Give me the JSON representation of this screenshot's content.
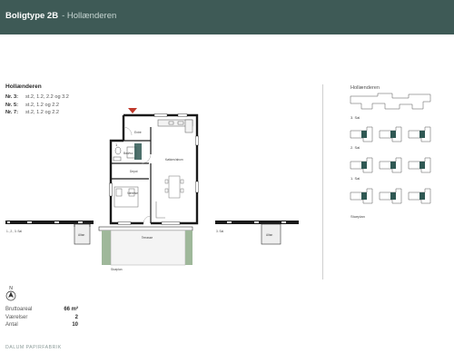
{
  "header": {
    "title": "Boligtype 2B",
    "subtitle": "- Hollænderen"
  },
  "project_label": "Hollænderen",
  "units": [
    {
      "nr": "Nr. 3:",
      "floors": "st.2, 1.2, 2.2 og 3.2"
    },
    {
      "nr": "Nr. 5:",
      "floors": "st.2, 1.2 og 2.2"
    },
    {
      "nr": "Nr. 7:",
      "floors": "st.2, 1.2 og 2.2"
    }
  ],
  "plan_labels": {
    "entre": "Entré",
    "bad": "Bad/wc",
    "depot": "Depot",
    "vaerelse": "Værelse",
    "koekken": "Køkken/alrum",
    "vaerelse_nr": "1",
    "terrasse": "Terrasse",
    "altan_left": "Altan",
    "altan_right": "Altan",
    "left_note": "1., 2., 3. Sal",
    "right_note": "3. Sal",
    "stueplan": "Stueplan"
  },
  "keymap": {
    "title": "Hollænderen",
    "floors": [
      "3. Sal",
      "2. Sal",
      "1. Sal",
      "Stueplan"
    ]
  },
  "compass_letter": "N",
  "stats": [
    {
      "label": "Bruttoareal",
      "value": "66 m²"
    },
    {
      "label": "Værelser",
      "value": "2"
    },
    {
      "label": "Antal",
      "value": "10"
    }
  ],
  "footer": "DALUM PAPIRFABRIK",
  "colors": {
    "header_bg": "#3e5a56",
    "accent_red": "#c0392b",
    "accent_teal": "#2f5853",
    "wall": "#1a1a1a",
    "terrace_green": "#9fb89a"
  }
}
